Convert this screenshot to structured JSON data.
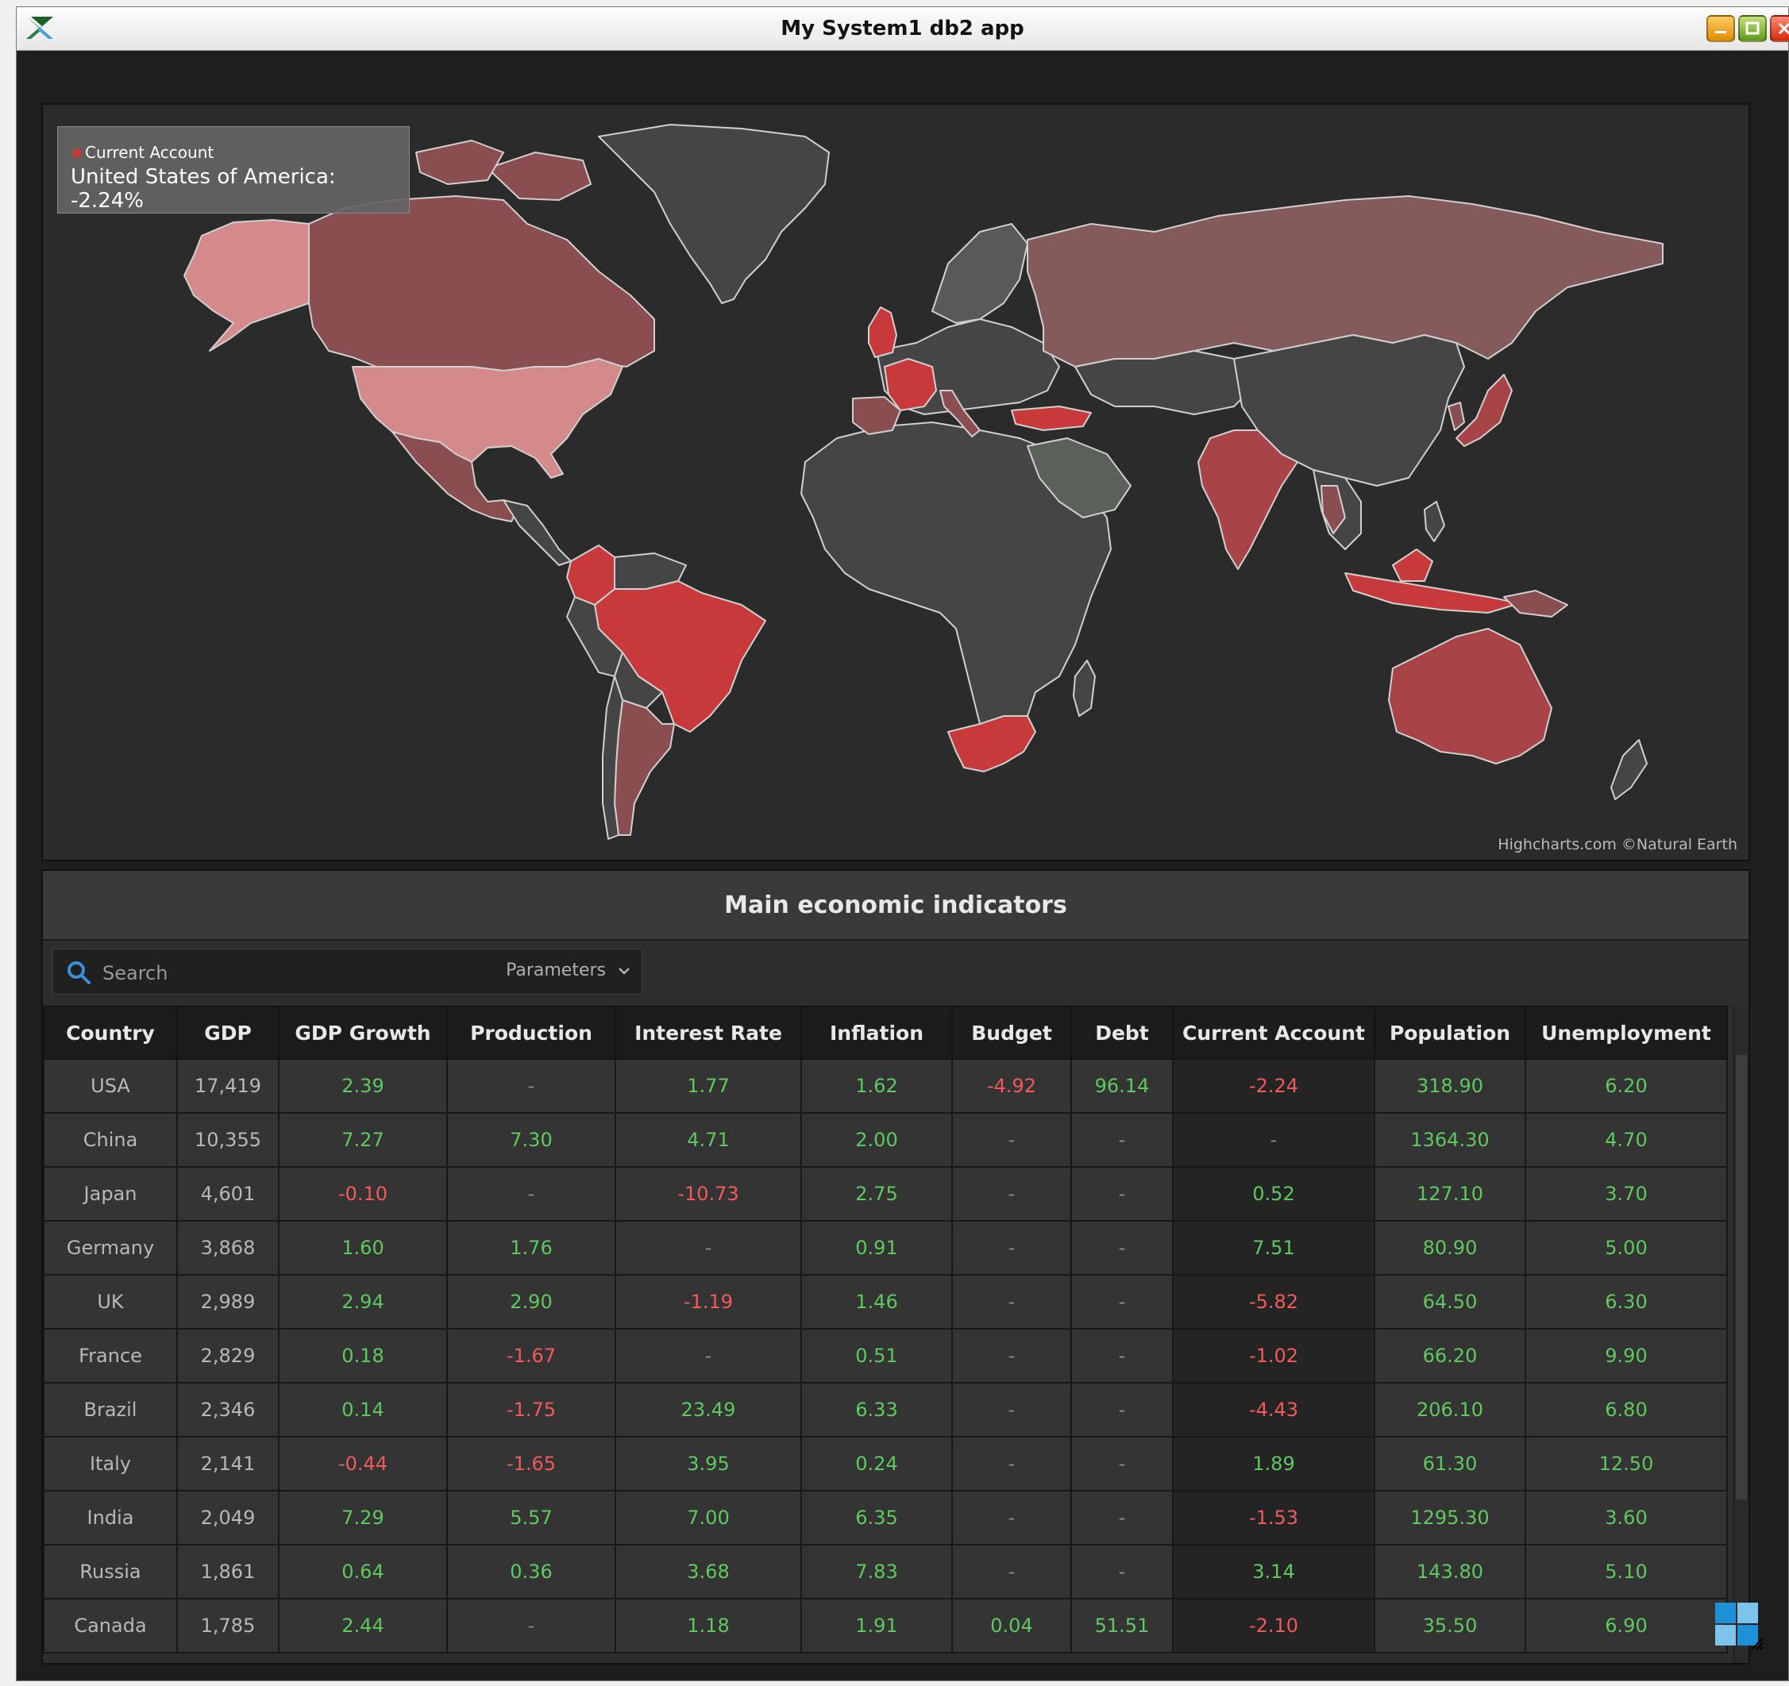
{
  "window": {
    "title": "My System1 db2 app",
    "icon": "app-logo-icon",
    "controls": [
      "minimize-icon",
      "maximize-icon",
      "close-icon"
    ]
  },
  "map": {
    "tooltip": {
      "series": "Current Account",
      "point": "United States of America: -2.24%"
    },
    "credits": "Highcharts.com ©Natural Earth",
    "colors": {
      "background": "#2b2b2b",
      "no_data": "#454545",
      "border": "#e0e0e0",
      "scale_low": "#d88a8a",
      "scale_high": "#c8393b"
    }
  },
  "panel": {
    "title": "Main economic indicators",
    "search_placeholder": "Search",
    "parameters_label": "Parameters"
  },
  "table": {
    "columns": [
      "Country",
      "GDP",
      "GDP Growth",
      "Production",
      "Interest Rate",
      "Inflation",
      "Budget",
      "Debt",
      "Current Account",
      "Population",
      "Unemployment"
    ],
    "rows": [
      [
        "USA",
        "17,419",
        "2.39",
        "-",
        "1.77",
        "1.62",
        "-4.92",
        "96.14",
        "-2.24",
        "318.90",
        "6.20"
      ],
      [
        "China",
        "10,355",
        "7.27",
        "7.30",
        "4.71",
        "2.00",
        "-",
        "-",
        "-",
        "1364.30",
        "4.70"
      ],
      [
        "Japan",
        "4,601",
        "-0.10",
        "-",
        "-10.73",
        "2.75",
        "-",
        "-",
        "0.52",
        "127.10",
        "3.70"
      ],
      [
        "Germany",
        "3,868",
        "1.60",
        "1.76",
        "-",
        "0.91",
        "-",
        "-",
        "7.51",
        "80.90",
        "5.00"
      ],
      [
        "UK",
        "2,989",
        "2.94",
        "2.90",
        "-1.19",
        "1.46",
        "-",
        "-",
        "-5.82",
        "64.50",
        "6.30"
      ],
      [
        "France",
        "2,829",
        "0.18",
        "-1.67",
        "-",
        "0.51",
        "-",
        "-",
        "-1.02",
        "66.20",
        "9.90"
      ],
      [
        "Brazil",
        "2,346",
        "0.14",
        "-1.75",
        "23.49",
        "6.33",
        "-",
        "-",
        "-4.43",
        "206.10",
        "6.80"
      ],
      [
        "Italy",
        "2,141",
        "-0.44",
        "-1.65",
        "3.95",
        "0.24",
        "-",
        "-",
        "1.89",
        "61.30",
        "12.50"
      ],
      [
        "India",
        "2,049",
        "7.29",
        "5.57",
        "7.00",
        "6.35",
        "-",
        "-",
        "-1.53",
        "1295.30",
        "3.60"
      ],
      [
        "Russia",
        "1,861",
        "0.64",
        "0.36",
        "3.68",
        "7.83",
        "-",
        "-",
        "3.14",
        "143.80",
        "5.10"
      ],
      [
        "Canada",
        "1,785",
        "2.44",
        "-",
        "1.18",
        "1.91",
        "0.04",
        "51.51",
        "-2.10",
        "35.50",
        "6.90"
      ]
    ],
    "value_colors": {
      "positive": "#5fc95f",
      "negative": "#f05a5a",
      "empty": "#8a8a8a"
    }
  },
  "icons": {
    "search": "search-icon",
    "chevron": "chevron-down-icon",
    "corner": "grid-widget-icon"
  }
}
